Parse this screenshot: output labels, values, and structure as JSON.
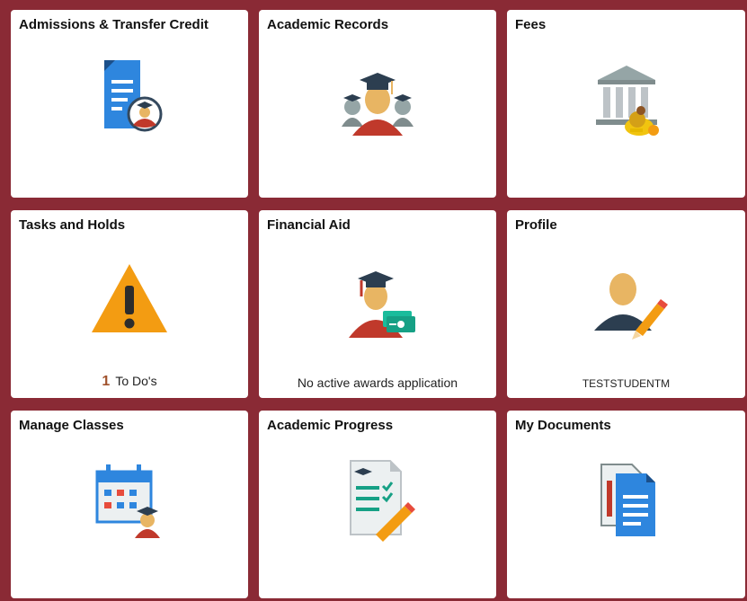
{
  "tiles": [
    {
      "title": "Admissions & Transfer Credit",
      "icon": "document-graduate-icon"
    },
    {
      "title": "Academic Records",
      "icon": "graduates-group-icon"
    },
    {
      "title": "Fees",
      "icon": "bank-coins-icon"
    },
    {
      "title": "Tasks and Holds",
      "icon": "warning-icon",
      "count": "1",
      "footer": "To Do's"
    },
    {
      "title": "Financial Aid",
      "icon": "graduate-money-icon",
      "footer": "No active awards application"
    },
    {
      "title": "Profile",
      "icon": "person-edit-icon",
      "footer": "TESTSTUDENTM"
    },
    {
      "title": "Manage Classes",
      "icon": "calendar-graduate-icon"
    },
    {
      "title": "Academic Progress",
      "icon": "checklist-pencil-icon"
    },
    {
      "title": "My Documents",
      "icon": "documents-icon"
    }
  ],
  "colors": {
    "background": "#8a2a35",
    "tile": "#ffffff",
    "accent_blue": "#2e86de",
    "warning": "#f39c12",
    "skin": "#e8b563",
    "red": "#c0392b",
    "navy": "#2c3e50",
    "teal": "#16a085"
  }
}
